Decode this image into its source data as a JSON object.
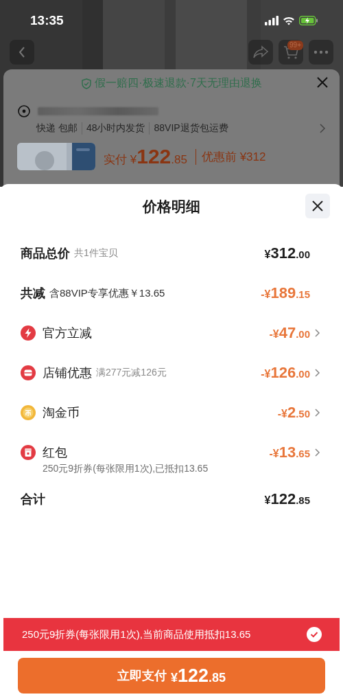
{
  "status_bar": {
    "time": "13:35"
  },
  "nav": {
    "cart_badge": "99+"
  },
  "background_sheet": {
    "guarantee": "假一赔四·极速退款·7天无理由退换",
    "shipping": [
      "快递 包邮",
      "48小时内发货",
      "88VIP退货包运费"
    ],
    "price_label": "实付",
    "price": {
      "prefix": "¥",
      "integer": "122",
      "decimal": ".85"
    },
    "original_price": "优惠前 ¥312"
  },
  "sheet": {
    "title": "价格明细",
    "rows": [
      {
        "kind": "subtotal",
        "label": "商品总价",
        "note": "共1件宝贝",
        "amount": {
          "prefix": "¥",
          "integer": "312",
          "decimal": ".00"
        }
      },
      {
        "kind": "reduction",
        "label": "共减",
        "note": "含88VIP专享优惠￥13.65",
        "amount": {
          "prefix": "-¥",
          "integer": "189",
          "decimal": ".15"
        }
      },
      {
        "kind": "official",
        "label": "官方立减",
        "amount": {
          "prefix": "-¥",
          "integer": "47",
          "decimal": ".00"
        }
      },
      {
        "kind": "store",
        "label": "店铺优惠",
        "note": "满277元减126元",
        "amount": {
          "prefix": "-¥",
          "integer": "126",
          "decimal": ".00"
        }
      },
      {
        "kind": "coins",
        "label": "淘金币",
        "amount": {
          "prefix": "-¥",
          "integer": "2",
          "decimal": ".50"
        }
      },
      {
        "kind": "red_packet",
        "label": "红包",
        "amount": {
          "prefix": "-¥",
          "integer": "13",
          "decimal": ".65"
        },
        "detail": "250元9折券(每张限用1次),已抵扣13.65"
      },
      {
        "kind": "total",
        "label": "合计",
        "amount": {
          "prefix": "¥",
          "integer": "122",
          "decimal": ".85"
        }
      }
    ],
    "banner": {
      "text": "250元9折券(每张限用1次),当前商品使用抵扣13.65",
      "checked": true
    },
    "pay_button": {
      "label": "立即支付",
      "price": {
        "prefix": "¥",
        "integer": "122",
        "decimal": ".85"
      }
    }
  }
}
